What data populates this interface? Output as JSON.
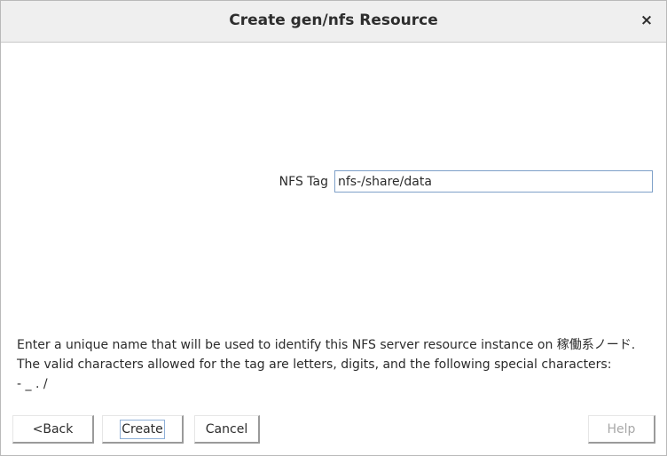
{
  "dialog": {
    "title": "Create gen/nfs Resource",
    "close_label": "×"
  },
  "form": {
    "tag_label": "NFS Tag",
    "tag_value": "nfs-/share/data"
  },
  "help": {
    "line1": "Enter a unique name that will be used to identify this NFS server resource instance on 稼働系ノード.",
    "line2": "The valid characters allowed for the tag are letters, digits, and the following special characters:",
    "line3": "- _ . /"
  },
  "buttons": {
    "back": "<Back",
    "create": "Create",
    "cancel": "Cancel",
    "help": "Help"
  }
}
